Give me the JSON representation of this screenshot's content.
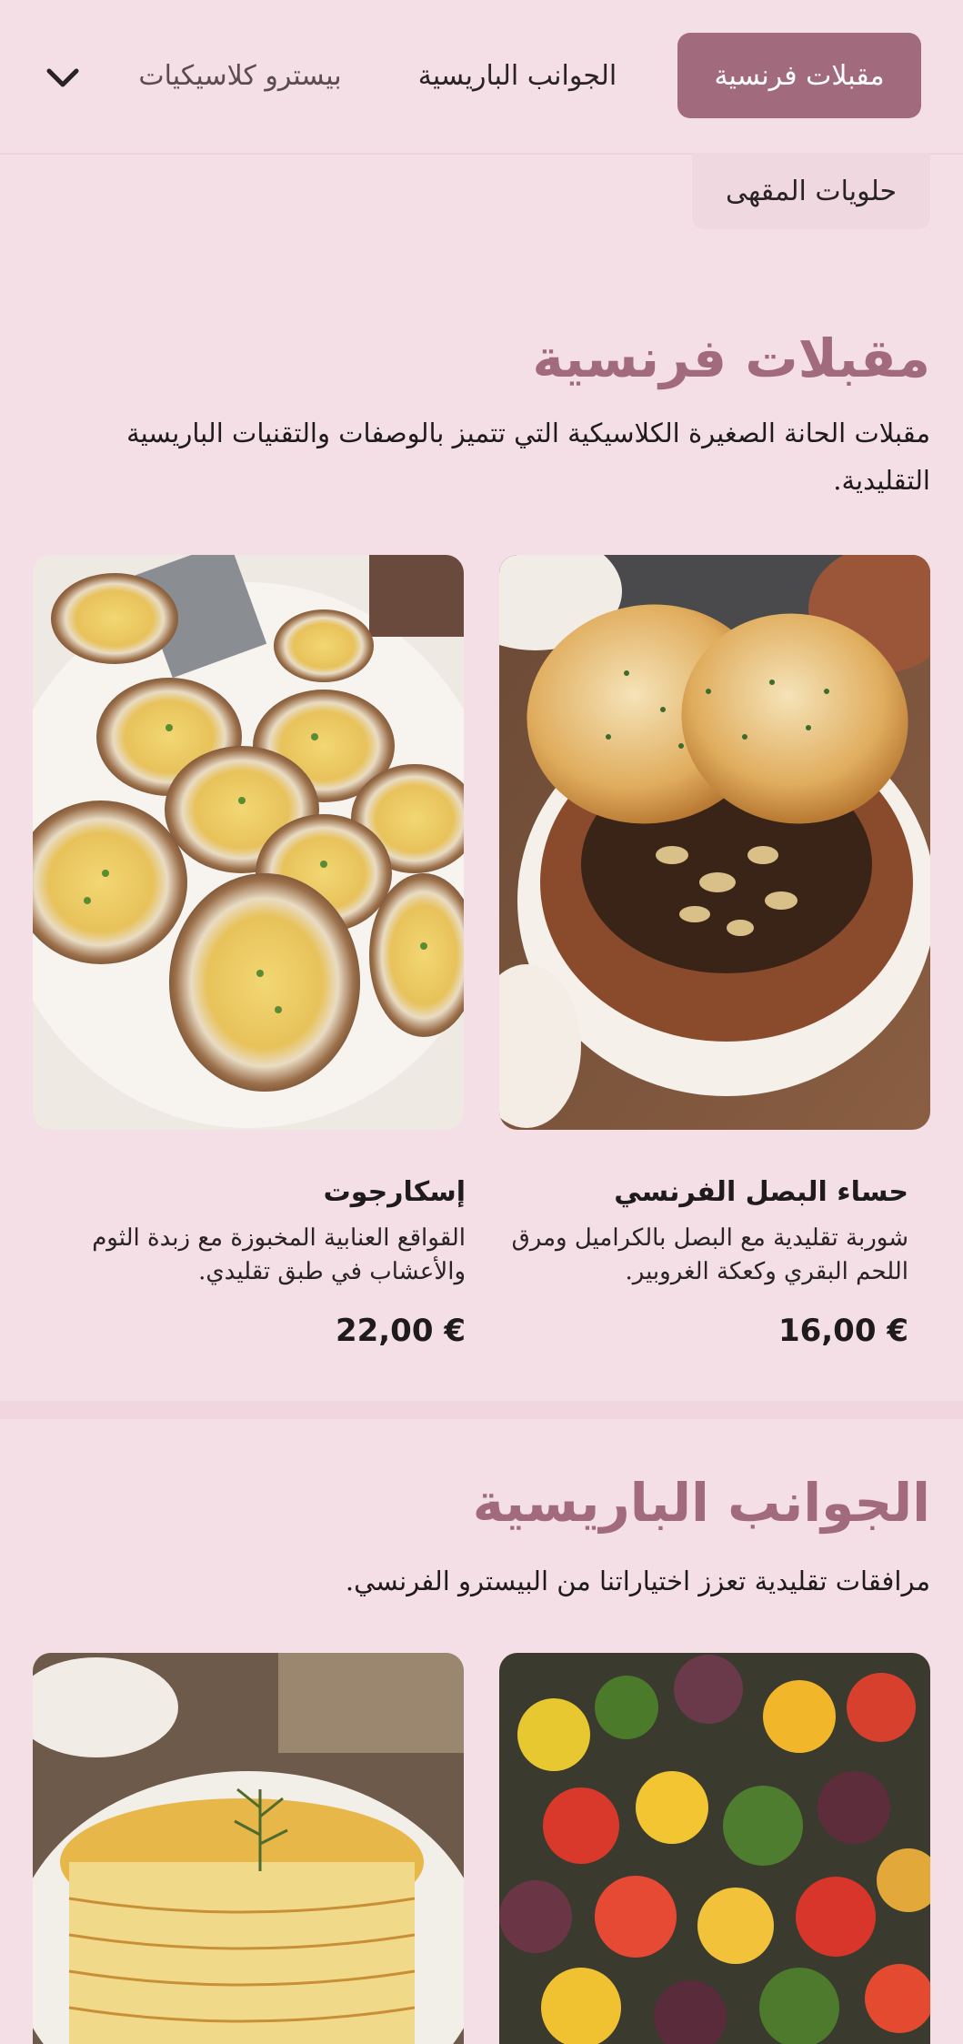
{
  "nav": {
    "tabs": [
      {
        "label": "مقبلات فرنسية",
        "active": true
      },
      {
        "label": "الجوانب الباريسية",
        "active": false
      },
      {
        "label": "بيسترو كلاسيكيات",
        "active": false
      },
      {
        "label": "حلويات المقهى",
        "active": false
      }
    ],
    "expand_icon": "chevron-down-icon"
  },
  "sections": [
    {
      "title": "مقبلات فرنسية",
      "description": "مقبلات الحانة الصغيرة الكلاسيكية التي تتميز بالوصفات والتقنيات الباريسية التقليدية.",
      "items": [
        {
          "name": "حساء البصل الفرنسي",
          "description": "شوربة تقليدية مع البصل بالكراميل ومرق اللحم البقري وكعكة الغروبير.",
          "price": "16,00 €"
        },
        {
          "name": "إسكارجوت",
          "description": "القواقع العنابية المخبوزة مع زبدة الثوم والأعشاب في طبق تقليدي.",
          "price": "22,00 €"
        }
      ]
    },
    {
      "title": "الجوانب الباريسية",
      "description": "مرافقات تقليدية تعزز اختياراتنا من البيسترو الفرنسي."
    }
  ],
  "colors": {
    "background": "#f4dfe7",
    "accent": "#a26a7d",
    "active_tab_text": "#ffffff"
  }
}
